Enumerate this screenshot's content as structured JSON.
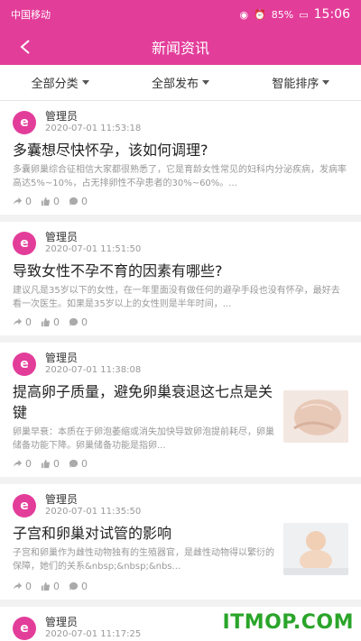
{
  "status_bar": {
    "carrier": "中国移动",
    "battery": "85%",
    "time": "15:06"
  },
  "nav": {
    "title": "新闻资讯"
  },
  "filters": {
    "category": "全部分类",
    "publish": "全部发布",
    "sort": "智能排序"
  },
  "articles": [
    {
      "author": "管理员",
      "date": "2020-07-01 11:53:18",
      "title": "多囊想尽快怀孕，该如何调理?",
      "excerpt": "多囊卵巢综合征相信大家都很熟悉了，它是育龄女性常见的妇科内分泌疾病，发病率高达5%~10%，占无排卵性不孕患者的30%~60%。...",
      "shares": "0",
      "likes": "0",
      "comments": "0"
    },
    {
      "author": "管理员",
      "date": "2020-07-01 11:51:50",
      "title": "导致女性不孕不育的因素有哪些?",
      "excerpt": "建议凡是35岁以下的女性，在一年里面没有做任何的避孕手段也没有怀孕，最好去看一次医生。如果是35岁以上的女性则是半年时间，...",
      "shares": "0",
      "likes": "0",
      "comments": "0"
    },
    {
      "author": "管理员",
      "date": "2020-07-01 11:38:08",
      "title": "提高卵子质量，避免卵巢衰退这七点是关键",
      "excerpt": "卵巢早衰：本质在于卵泡萎缩或消失加快导致卵泡提前耗尽，卵巢储备功能下降。卵巢储备功能是指卵...",
      "shares": "0",
      "likes": "0",
      "comments": "0"
    },
    {
      "author": "管理员",
      "date": "2020-07-01 11:35:50",
      "title": "子宫和卵巢对试管的影响",
      "excerpt": "子宫和卵巢作为雌性动物独有的生殖器官，是雌性动物得以繁衍的保障，她们的关系&nbsp;&nbsp;&nbs...",
      "shares": "0",
      "likes": "0",
      "comments": "0"
    },
    {
      "author": "管理员",
      "date": "2020-07-01 11:17:25",
      "title": "",
      "excerpt": "",
      "shares": "",
      "likes": "",
      "comments": ""
    }
  ],
  "watermark": "ITMOP.COM",
  "colors": {
    "brand": "#e33d9a",
    "watermark": "#2aa52a"
  }
}
